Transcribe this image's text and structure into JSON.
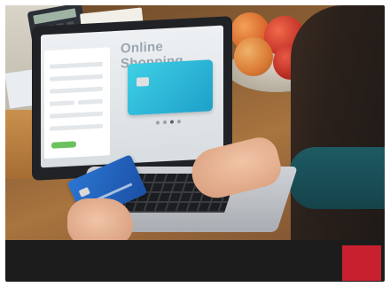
{
  "screen": {
    "title": "Online Shopping"
  },
  "colors": {
    "bottom_bar": "#1c1c1c",
    "accent": "#c8202e",
    "card_screen": "#2fbfe0",
    "card_held": "#2464c0"
  }
}
